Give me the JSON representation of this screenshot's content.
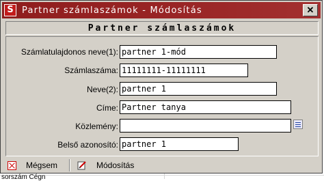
{
  "window": {
    "title": "Partner számlaszámok - Módosítás"
  },
  "header": {
    "title": "Partner számlaszámok"
  },
  "form": {
    "fields": [
      {
        "label": "Számlatulajdonos neve(1):",
        "value": "partner 1-mód"
      },
      {
        "label": "Számlaszáma:",
        "value": "11111111-11111111"
      },
      {
        "label": "Neve(2):",
        "value": "partner 1"
      },
      {
        "label": "Címe:",
        "value": "Partner tanya"
      },
      {
        "label": "Közlemény:",
        "value": ""
      },
      {
        "label": "Belső azonosító:",
        "value": "partner 1"
      }
    ]
  },
  "footer": {
    "cancel_label": "Mégsem",
    "modify_label": "Módosítás"
  },
  "background": {
    "bottom_text": "sorszám Cégn"
  },
  "colors": {
    "titlebar": "#9a2626",
    "dialog_face": "#d4d0c8",
    "cancel_icon": "#cc0000"
  }
}
